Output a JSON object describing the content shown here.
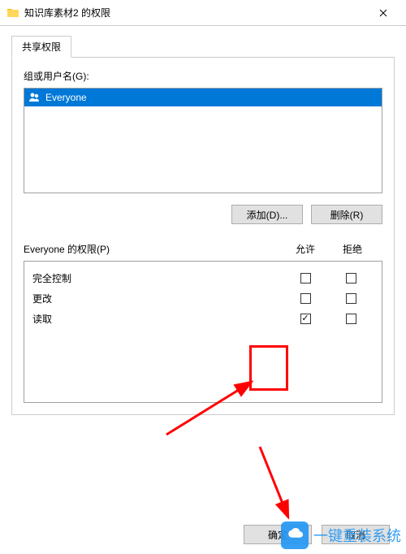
{
  "title": "知识库素材2 的权限",
  "tab": "共享权限",
  "group_label": "组或用户名(G):",
  "users": [
    {
      "name": "Everyone",
      "selected": true
    }
  ],
  "buttons": {
    "add": "添加(D)...",
    "remove": "删除(R)"
  },
  "perm_label": "Everyone 的权限(P)",
  "cols": {
    "allow": "允许",
    "deny": "拒绝"
  },
  "perms": [
    {
      "name": "完全控制",
      "allow": false,
      "deny": false
    },
    {
      "name": "更改",
      "allow": false,
      "deny": false
    },
    {
      "name": "读取",
      "allow": true,
      "deny": false
    }
  ],
  "dialog": {
    "ok": "确定",
    "cancel": "取消"
  },
  "watermark": {
    "text": "一键重装系统",
    "url": "www.baiyunxitong.com"
  }
}
